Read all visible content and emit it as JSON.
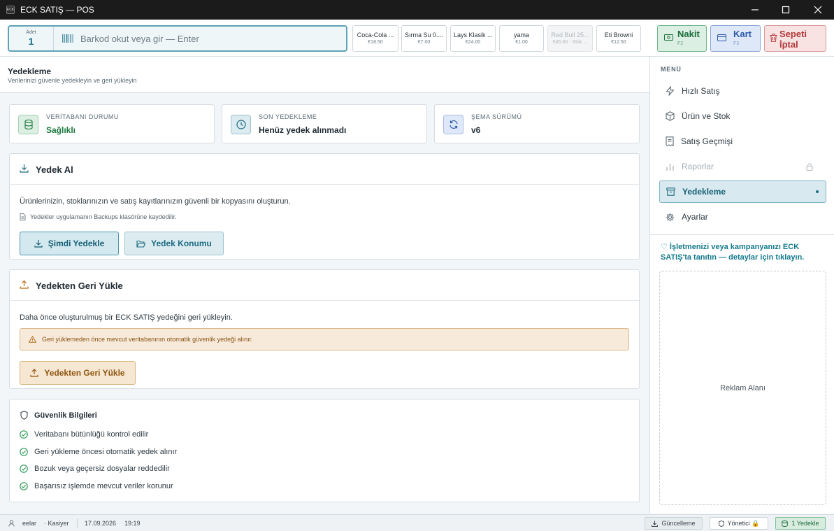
{
  "window": {
    "title": "ECK SATIŞ — POS",
    "icon_text": "ECK"
  },
  "scan": {
    "qty_label": "Adet",
    "qty_value": "1",
    "placeholder": "Barkod okut veya gir — Enter"
  },
  "quick_products": [
    {
      "name": "Coca-Cola ...",
      "price": "€18.50",
      "disabled": false
    },
    {
      "name": "Sırma Su 0....",
      "price": "€7.00",
      "disabled": false
    },
    {
      "name": "Lays Klasik ...",
      "price": "€24.00",
      "disabled": false
    },
    {
      "name": "yama",
      "price": "€1.00",
      "disabled": false
    },
    {
      "name": "Red Bull 25...",
      "price": "€45.00 · Stok ...",
      "disabled": true
    },
    {
      "name": "Eti Browni",
      "price": "€12.50",
      "disabled": false
    }
  ],
  "payment": {
    "cash": {
      "label": "Nakit",
      "key": "F2"
    },
    "card": {
      "label": "Kart",
      "key": "F3"
    },
    "cancel": {
      "label": "Sepeti İptal",
      "key": "F4"
    }
  },
  "page": {
    "title": "Yedekleme",
    "subtitle": "Verilerinizi güvenle yedekleyin ve geri yükleyin"
  },
  "stats": [
    {
      "label": "VERİTABANI DURUMU",
      "value": "Sağlıklı",
      "color": "#1d7a3e"
    },
    {
      "label": "SON YEDEKLEME",
      "value": "Henüz yedek alınmadı",
      "color": "#1f2a33"
    },
    {
      "label": "ŞEMA SÜRÜMÜ",
      "value": "v6",
      "color": "#1f2a33"
    }
  ],
  "backup": {
    "title": "Yedek Al",
    "description": "Ürünlerinizin, stoklarınızın ve satış kayıtlarınızın güvenli bir kopyasını oluşturun.",
    "note": "Yedekler uygulamanın Backups klasörüne kaydedilir.",
    "primary_button": "Şimdi Yedekle",
    "secondary_button": "Yedek Konumu"
  },
  "restore": {
    "title": "Yedekten Geri Yükle",
    "description": "Daha önce oluşturulmuş bir ECK SATIŞ yedeğini geri yükleyin.",
    "warning": "Geri yüklemeden önce mevcut veritabanının otomatik güvenlik yedeği alınır.",
    "button": "Yedekten Geri Yükle"
  },
  "security": {
    "title": "Güvenlik Bilgileri",
    "items": [
      "Veritabanı bütünlüğü kontrol edilir",
      "Geri yükleme öncesi otomatik yedek alınır",
      "Bozuk veya geçersiz dosyalar reddedilir",
      "Başarısız işlemde mevcut veriler korunur"
    ]
  },
  "sidebar": {
    "menu_label": "MENÜ",
    "items": [
      {
        "label": "Hızlı Satış",
        "icon": "bolt-icon",
        "state": "normal"
      },
      {
        "label": "Ürün ve Stok",
        "icon": "box-icon",
        "state": "normal"
      },
      {
        "label": "Satış Geçmişi",
        "icon": "receipt-icon",
        "state": "normal"
      },
      {
        "label": "Raporlar",
        "icon": "chart-icon",
        "state": "disabled"
      },
      {
        "label": "Yedekleme",
        "icon": "archive-icon",
        "state": "active"
      },
      {
        "label": "Ayarlar",
        "icon": "gear-icon",
        "state": "normal"
      }
    ],
    "promo": "♡ İşletmenizi veya kampanyanızı ECK SATIŞ'ta tanıtın — detaylar için tıklayın.",
    "ad_label": "Reklam Alanı"
  },
  "status": {
    "user": "eelar",
    "role": "· Kasiyer",
    "date": "17.09.2026",
    "time": "19:19",
    "update_button": "Güncelleme",
    "admin_button": "Yönetici 🔒",
    "backup_button": "1 Yedekle"
  },
  "colors": {
    "accent": "#1c6b82",
    "success": "#1d7a3e",
    "warning": "#8e5510",
    "danger": "#b23838"
  }
}
